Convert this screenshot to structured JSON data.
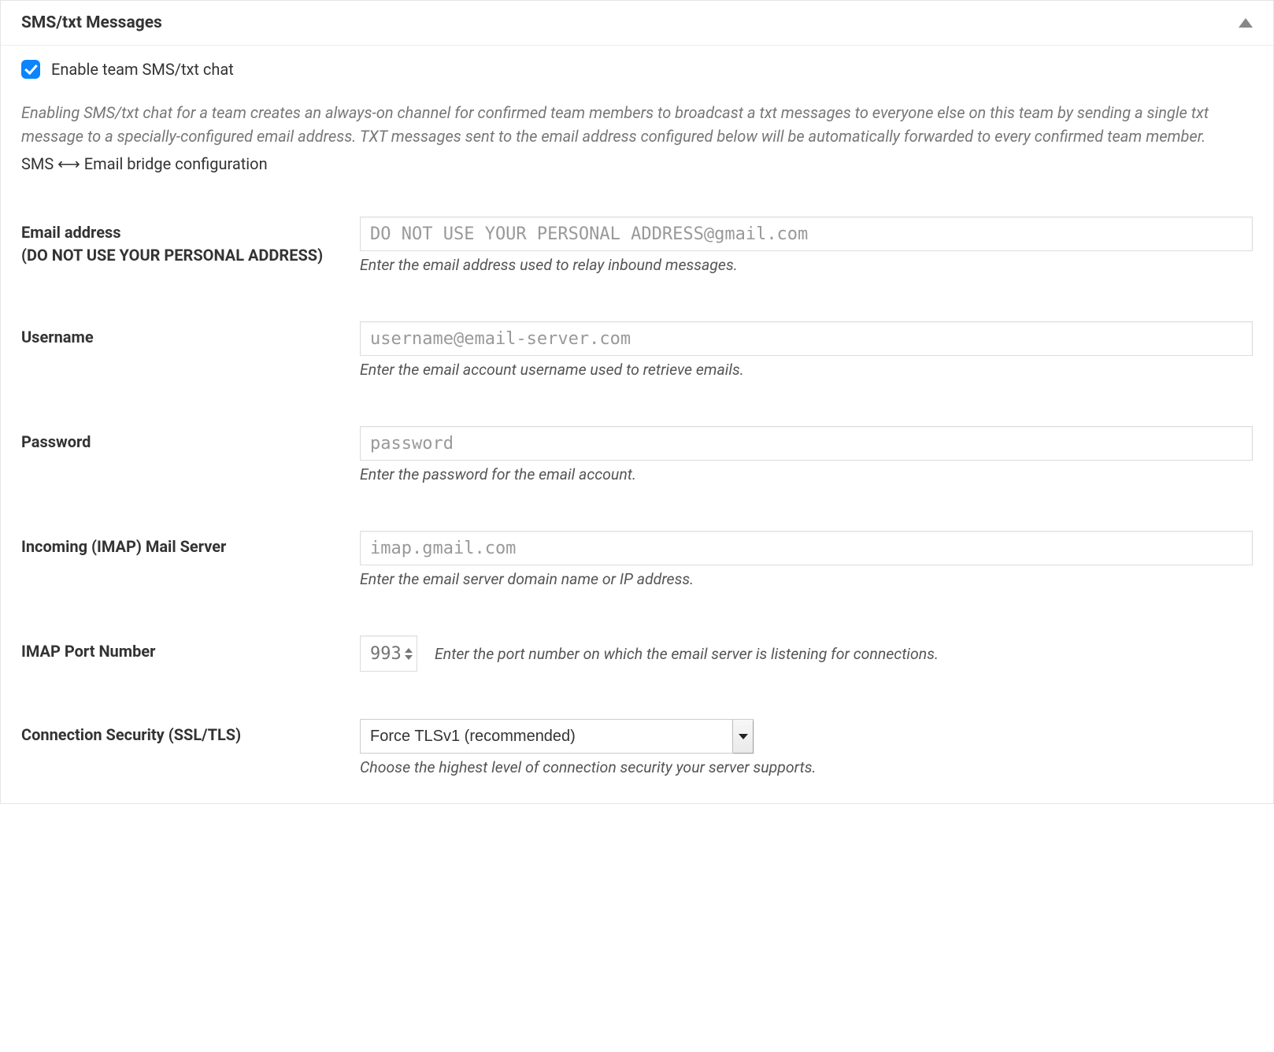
{
  "panel": {
    "title": "SMS/txt Messages"
  },
  "enable": {
    "label": "Enable team SMS/txt chat",
    "checked": true
  },
  "description": "Enabling SMS/txt chat for a team creates an always-on channel for confirmed team members to broadcast a txt messages to everyone else on this team by sending a single txt message to a specially-configured email address. TXT messages sent to the email address configured below will be automatically forwarded to every confirmed team member.",
  "subheading": "SMS ⟷ Email bridge configuration",
  "fields": {
    "email": {
      "label": "Email address\n(DO NOT USE YOUR PERSONAL ADDRESS)",
      "placeholder": "DO NOT USE YOUR PERSONAL ADDRESS@gmail.com",
      "help": "Enter the email address used to relay inbound messages."
    },
    "username": {
      "label": "Username",
      "placeholder": "username@email-server.com",
      "help": "Enter the email account username used to retrieve emails."
    },
    "password": {
      "label": "Password",
      "placeholder": "password",
      "help": "Enter the password for the email account."
    },
    "imap_server": {
      "label": "Incoming (IMAP) Mail Server",
      "placeholder": "imap.gmail.com",
      "help": "Enter the email server domain name or IP address."
    },
    "imap_port": {
      "label": "IMAP Port Number",
      "value": "993",
      "help": "Enter the port number on which the email server is listening for connections."
    },
    "security": {
      "label": "Connection Security (SSL/TLS)",
      "selected": "Force TLSv1 (recommended)",
      "help": "Choose the highest level of connection security your server supports."
    }
  }
}
